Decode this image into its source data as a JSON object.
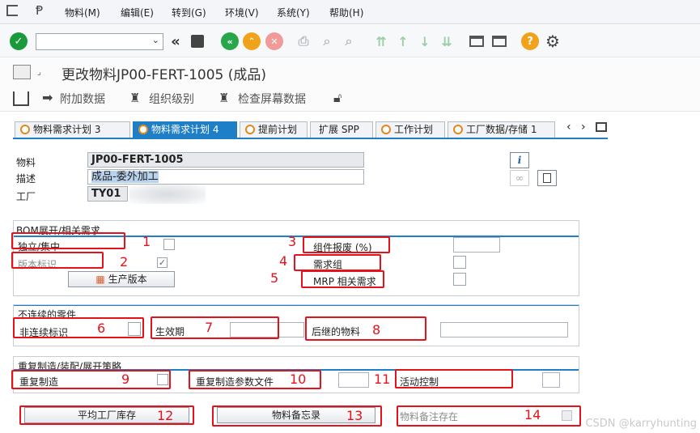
{
  "menu": [
    "物料(M)",
    "编辑(E)",
    "转到(G)",
    "环境(V)",
    "系统(Y)",
    "帮助(H)"
  ],
  "title": "更改物料JP00-FERT-1005 (成品)",
  "app_toolbar": [
    "附加数据",
    "组织级别",
    "检查屏幕数据"
  ],
  "tabs": [
    "物料需求计划 3",
    "物料需求计划 4",
    "提前计划",
    "扩展 SPP",
    "工作计划",
    "工厂数据/存储 1"
  ],
  "header_fields": {
    "material_label": "物料",
    "material_value": "JP00-FERT-1005",
    "desc_label": "描述",
    "desc_value": "成品-委外加工",
    "plant_label": "工厂",
    "plant_value": "TY01"
  },
  "bom": {
    "title": "BOM展开/相关需求",
    "independent_collective": "独立/集中",
    "version_indicator": "版本标识",
    "production_version_button": "生产版本",
    "component_scrap": "组件报废 (%)",
    "requirements_group": "需求组",
    "mrp_dependent_req": "MRP 相关需求"
  },
  "discontinued": {
    "title": "不连续的零件",
    "indicator": "非连续标识",
    "effective_out": "生效期",
    "follow_up_material": "后继的物料"
  },
  "repetitive": {
    "title": "重复制造/装配/展开策略",
    "repetitive_mfg": "重复制造",
    "rem_profile": "重复制造参数文件",
    "action_control": "活动控制"
  },
  "bottom": {
    "avg_plant_stock": "平均工厂库存",
    "material_memo": "物料备忘录",
    "memo_exists": "物料备注存在"
  },
  "annotations": [
    "1",
    "2",
    "3",
    "4",
    "5",
    "6",
    "7",
    "8",
    "9",
    "10",
    "11",
    "12",
    "13",
    "14"
  ],
  "watermark": "CSDN @karryhunting",
  "colors": {
    "accent": "#1e7fc6",
    "annotation": "#e5121b"
  }
}
